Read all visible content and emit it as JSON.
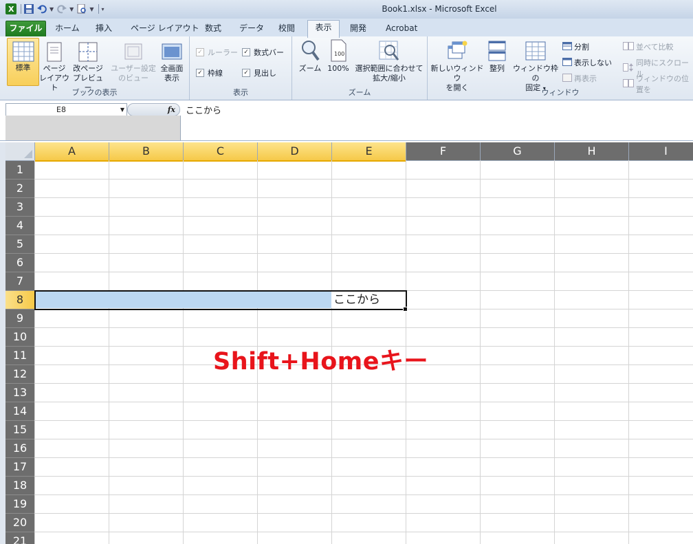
{
  "window": {
    "title": "Book1.xlsx - Microsoft Excel"
  },
  "tabs": [
    {
      "label": "ファイル"
    },
    {
      "label": "ホーム"
    },
    {
      "label": "挿入"
    },
    {
      "label": "ページ レイアウト"
    },
    {
      "label": "数式"
    },
    {
      "label": "データ"
    },
    {
      "label": "校閲"
    },
    {
      "label": "表示"
    },
    {
      "label": "開発"
    },
    {
      "label": "Acrobat"
    }
  ],
  "ribbon": {
    "book_view": {
      "label": "ブックの表示",
      "normal": "標準",
      "page_layout_1": "ページ",
      "page_layout_2": "レイアウト",
      "page_break_1": "改ページ",
      "page_break_2": "プレビュー",
      "custom_1": "ユーザー設定",
      "custom_2": "のビュー",
      "fullscreen_1": "全画面",
      "fullscreen_2": "表示"
    },
    "show": {
      "label": "表示",
      "ruler": "ルーラー",
      "formula_bar": "数式バー",
      "gridlines": "枠線",
      "headings": "見出し"
    },
    "zoom": {
      "label": "ズーム",
      "zoom": "ズーム",
      "hundred": "100%",
      "selection_1": "選択範囲に合わせて",
      "selection_2": "拡大/縮小"
    },
    "window": {
      "label": "ウィンドウ",
      "new_1": "新しいウィンドウ",
      "new_2": "を開く",
      "arrange": "整列",
      "freeze_1": "ウィンドウ枠の",
      "freeze_2": "固定",
      "split": "分割",
      "hide": "表示しない",
      "unhide": "再表示",
      "side": "並べて比較",
      "sync": "同時にスクロール",
      "reset": "ウィンドウの位置を"
    }
  },
  "formula_bar": {
    "name_box": "E8",
    "fx": "fx",
    "content": "ここから"
  },
  "grid": {
    "columns": [
      "A",
      "B",
      "C",
      "D",
      "E",
      "F",
      "G",
      "H",
      "I"
    ],
    "rows": [
      "1",
      "2",
      "3",
      "4",
      "5",
      "6",
      "7",
      "8",
      "9",
      "10",
      "11",
      "12",
      "13",
      "14",
      "15",
      "16",
      "17",
      "18",
      "19",
      "20",
      "21"
    ],
    "active_cell_text": "ここから"
  },
  "annotation": "Shift+Homeキー"
}
